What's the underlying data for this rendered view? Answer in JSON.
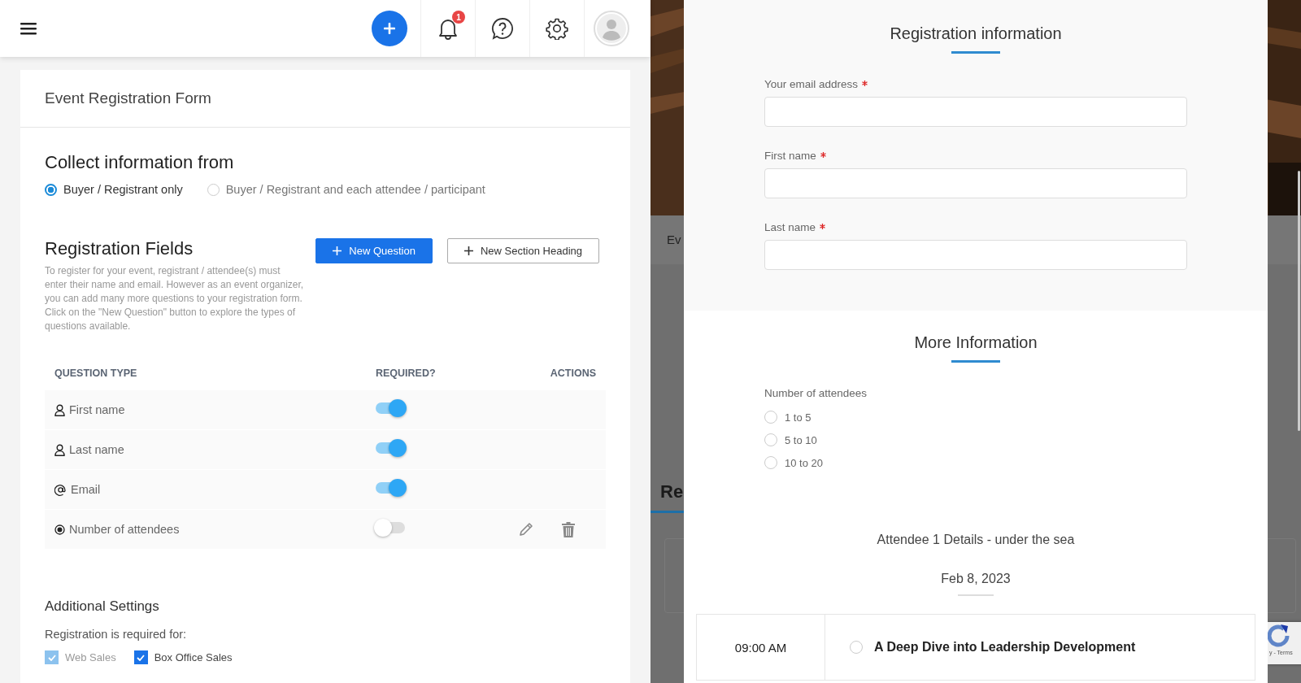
{
  "header": {
    "notification_count": "1"
  },
  "form_card": {
    "title": "Event Registration Form",
    "collect": {
      "heading": "Collect information from",
      "options": [
        {
          "label": "Buyer / Registrant only",
          "selected": true
        },
        {
          "label": "Buyer / Registrant and each attendee / participant",
          "selected": false
        }
      ]
    },
    "fields": {
      "heading": "Registration Fields",
      "description": "To register for your event, registrant / attendee(s) must enter their name and email. However as an event organizer, you can add many more questions to your registration form. Click on the \"New Question\" button to explore the types of questions available.",
      "buttons": [
        {
          "label": "New Question",
          "kind": "primary"
        },
        {
          "label": "New Section Heading",
          "kind": "outline"
        }
      ],
      "columns": [
        "QUESTION TYPE",
        "REQUIRED?",
        "ACTIONS"
      ],
      "rows": [
        {
          "label": "First name",
          "kind": "name",
          "required": true,
          "editable": false
        },
        {
          "label": "Last name",
          "kind": "name",
          "required": true,
          "editable": false
        },
        {
          "label": "Email",
          "kind": "email",
          "required": true,
          "editable": false
        },
        {
          "label": "Number of attendees",
          "kind": "choice",
          "required": false,
          "editable": true
        }
      ]
    },
    "additional": {
      "heading": "Additional Settings",
      "label": "Registration is required for:",
      "options": [
        {
          "label": "Web Sales",
          "checked": true,
          "disabled": true
        },
        {
          "label": "Box Office Sales",
          "checked": true,
          "disabled": false
        }
      ]
    }
  },
  "background_page": {
    "tab_fragment": "Ev",
    "heading_fragment": "Re",
    "recaptcha_text": "y - Terms"
  },
  "modal": {
    "registration": {
      "title": "Registration information",
      "fields": [
        {
          "label": "Your email address",
          "required": true
        },
        {
          "label": "First name",
          "required": true
        },
        {
          "label": "Last name",
          "required": true
        }
      ]
    },
    "more_info": {
      "title": "More Information",
      "question": "Number of attendees",
      "options": [
        {
          "label": "1 to 5",
          "selected": false
        },
        {
          "label": "5 to 10",
          "selected": false
        },
        {
          "label": "10 to 20",
          "selected": false
        }
      ]
    },
    "attendee": {
      "title": "Attendee 1 Details - under the sea",
      "date": "Feb 8, 2023",
      "sessions": [
        {
          "time": "09:00 AM",
          "title": "A Deep Dive into Leadership Development",
          "selected": false
        }
      ]
    }
  }
}
